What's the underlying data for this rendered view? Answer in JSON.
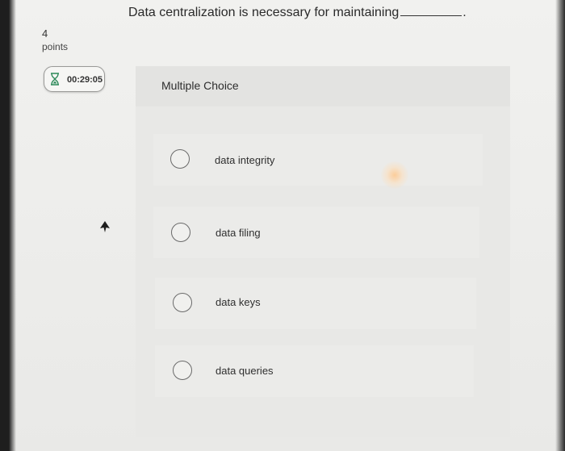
{
  "question": {
    "text": "Data centralization is necessary for maintaining",
    "period": "."
  },
  "points": {
    "value": "4",
    "label": "points"
  },
  "timer": {
    "icon": "hourglass-icon",
    "time": "00:29:05"
  },
  "panel": {
    "type_label": "Multiple Choice"
  },
  "options": [
    {
      "label": "data integrity"
    },
    {
      "label": "data filing"
    },
    {
      "label": "data keys"
    },
    {
      "label": "data queries"
    }
  ]
}
